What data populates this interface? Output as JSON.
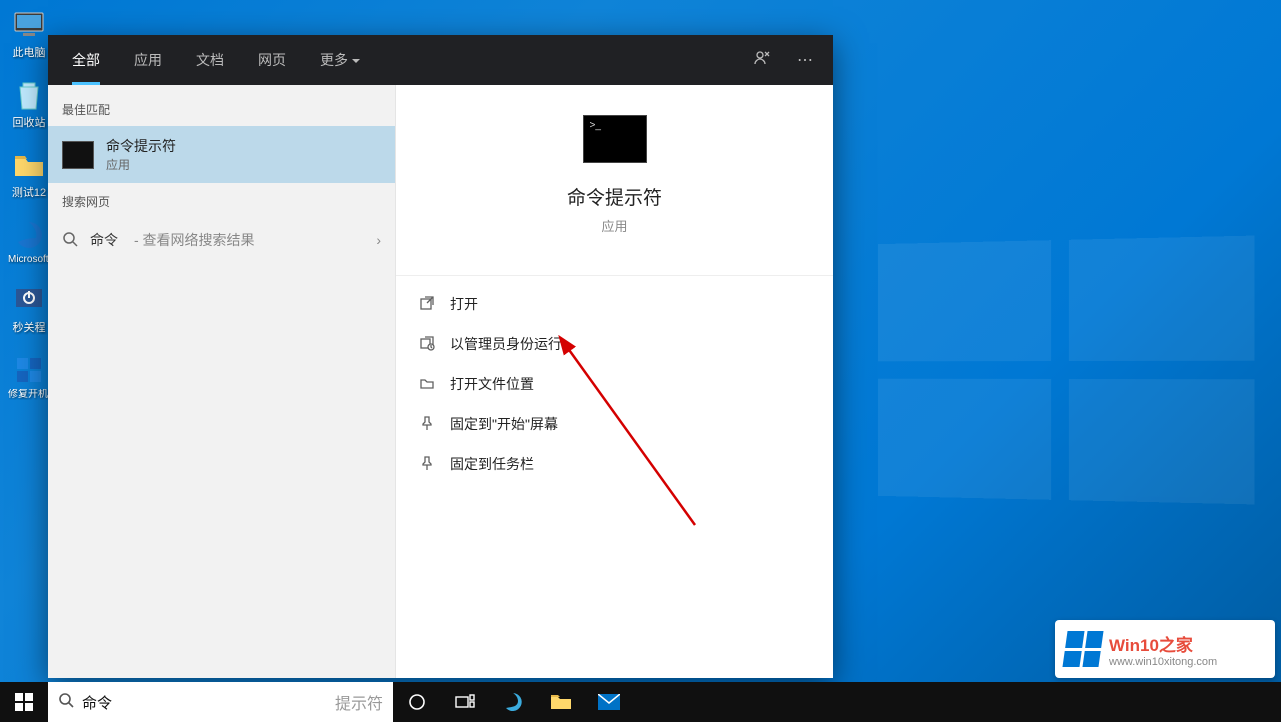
{
  "desktop_icons": [
    {
      "id": "this-pc",
      "label": "此电脑"
    },
    {
      "id": "recycle-bin",
      "label": "回收站"
    },
    {
      "id": "folder-test",
      "label": "测试12"
    },
    {
      "id": "edge",
      "label": "Microsoft Edge"
    },
    {
      "id": "shutdown",
      "label": "秒关程"
    },
    {
      "id": "repair",
      "label": "修复开机 屏"
    }
  ],
  "search_panel": {
    "tabs": [
      "全部",
      "应用",
      "文档",
      "网页",
      "更多"
    ],
    "active_tab": 0,
    "sections": {
      "best_match": "最佳匹配",
      "web": "搜索网页"
    },
    "best_result": {
      "title": "命令提示符",
      "sub": "应用"
    },
    "web_query": {
      "query": "命令",
      "hint": "- 查看网络搜索结果"
    },
    "preview": {
      "title": "命令提示符",
      "sub": "应用"
    },
    "actions": [
      {
        "icon": "open",
        "label": "打开"
      },
      {
        "icon": "admin",
        "label": "以管理员身份运行"
      },
      {
        "icon": "location",
        "label": "打开文件位置"
      },
      {
        "icon": "pin-start",
        "label": "固定到\"开始\"屏幕"
      },
      {
        "icon": "pin-taskbar",
        "label": "固定到任务栏"
      }
    ]
  },
  "taskbar": {
    "search_typed": "命令",
    "search_placeholder": "提示符"
  },
  "watermark": {
    "brand": "Win10",
    "suffix": "之家",
    "url": "www.win10xitong.com"
  }
}
